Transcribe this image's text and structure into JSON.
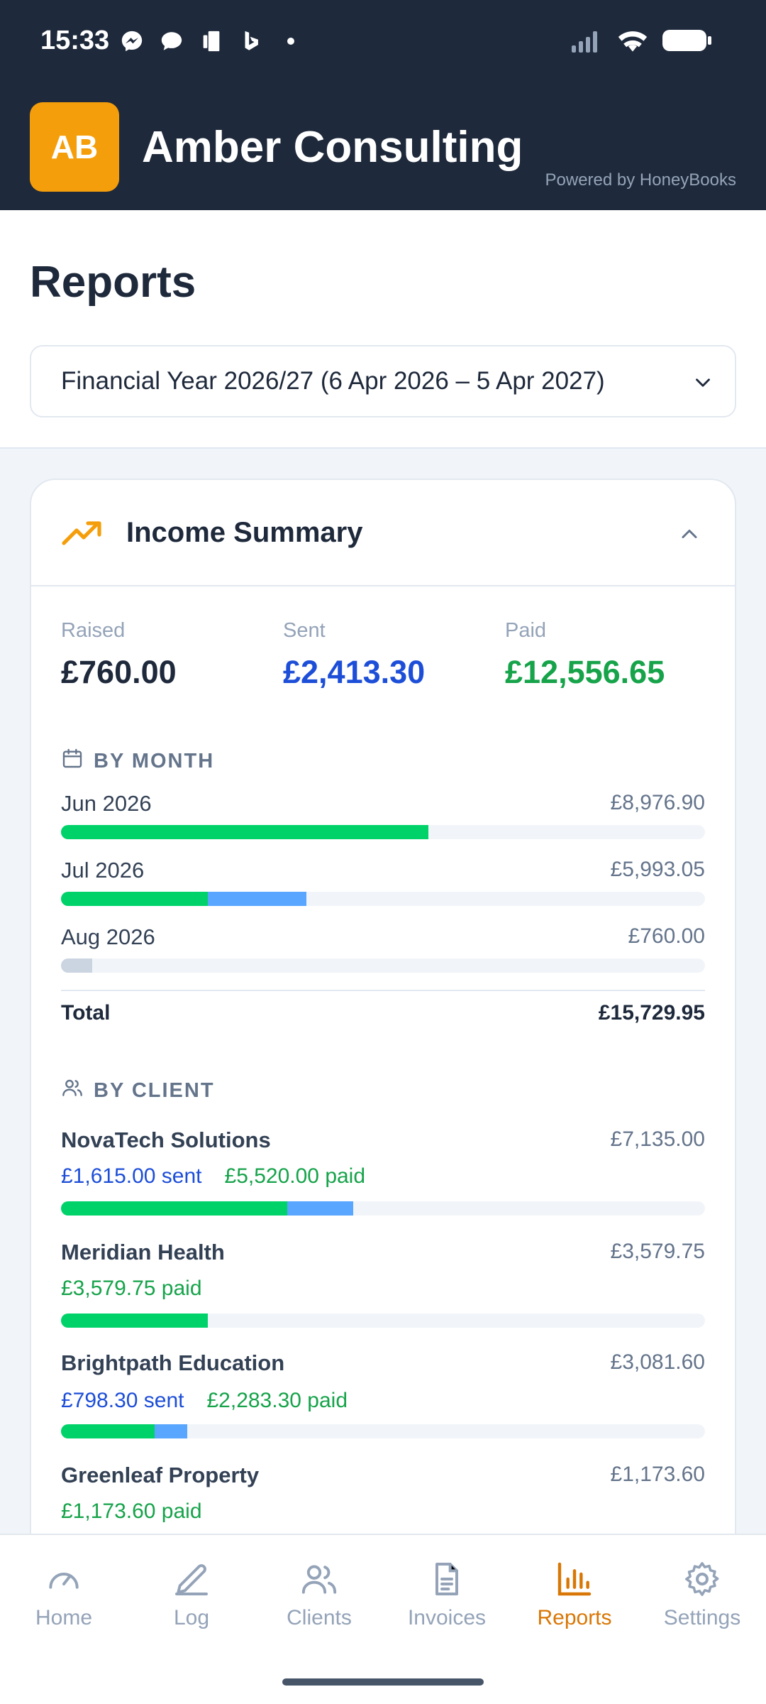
{
  "status_bar": {
    "time": "15:33"
  },
  "header": {
    "logo_initials": "AB",
    "company": "Amber Consulting",
    "powered_by": "Powered by HoneyBooks"
  },
  "page": {
    "title": "Reports",
    "period_select": "Financial Year 2026/27 (6 Apr 2026 – 5 Apr 2027)"
  },
  "summary": {
    "title": "Income Summary",
    "stats": [
      {
        "label": "Raised",
        "value": "£760.00",
        "color": "#1e293b"
      },
      {
        "label": "Sent",
        "value": "£2,413.30",
        "color": "#1d4ed8"
      },
      {
        "label": "Paid",
        "value": "£12,556.65",
        "color": "#16a34a"
      }
    ],
    "by_month": {
      "heading": "BY MONTH",
      "rows": [
        {
          "label": "Jun 2026",
          "value": "£8,976.90",
          "paid": 8976.9,
          "sent": 0,
          "raised": 0
        },
        {
          "label": "Jul 2026",
          "value": "£5,993.05",
          "paid": 3579.75,
          "sent": 2413.3,
          "raised": 0
        },
        {
          "label": "Aug 2026",
          "value": "£760.00",
          "paid": 0,
          "sent": 0,
          "raised": 760.0
        }
      ],
      "total_label": "Total",
      "total_value": "£15,729.95"
    },
    "by_client": {
      "heading": "BY CLIENT",
      "clients": [
        {
          "name": "NovaTech Solutions",
          "total": "£7,135.00",
          "sent_text": "£1,615.00 sent",
          "paid_text": "£5,520.00 paid",
          "sent": 1615.0,
          "paid": 5520.0
        },
        {
          "name": "Meridian Health",
          "total": "£3,579.75",
          "sent_text": "",
          "paid_text": "£3,579.75 paid",
          "sent": 0,
          "paid": 3579.75
        },
        {
          "name": "Brightpath Education",
          "total": "£3,081.60",
          "sent_text": "£798.30 sent",
          "paid_text": "£2,283.30 paid",
          "sent": 798.3,
          "paid": 2283.3
        },
        {
          "name": "Greenleaf Property",
          "total": "£1,173.60",
          "sent_text": "",
          "paid_text": "£1,173.60 paid",
          "sent": 0,
          "paid": 1173.6
        }
      ]
    },
    "colors": {
      "paid": "#00d26a",
      "sent": "#58a6ff",
      "raised": "#cbd5e1"
    },
    "scale_max": 15729.95
  },
  "nav": {
    "items": [
      {
        "label": "Home",
        "icon": "gauge-icon"
      },
      {
        "label": "Log",
        "icon": "pencil-icon"
      },
      {
        "label": "Clients",
        "icon": "users-icon"
      },
      {
        "label": "Invoices",
        "icon": "document-icon"
      },
      {
        "label": "Reports",
        "icon": "bar-chart-icon",
        "active": true
      },
      {
        "label": "Settings",
        "icon": "gear-icon"
      }
    ]
  }
}
